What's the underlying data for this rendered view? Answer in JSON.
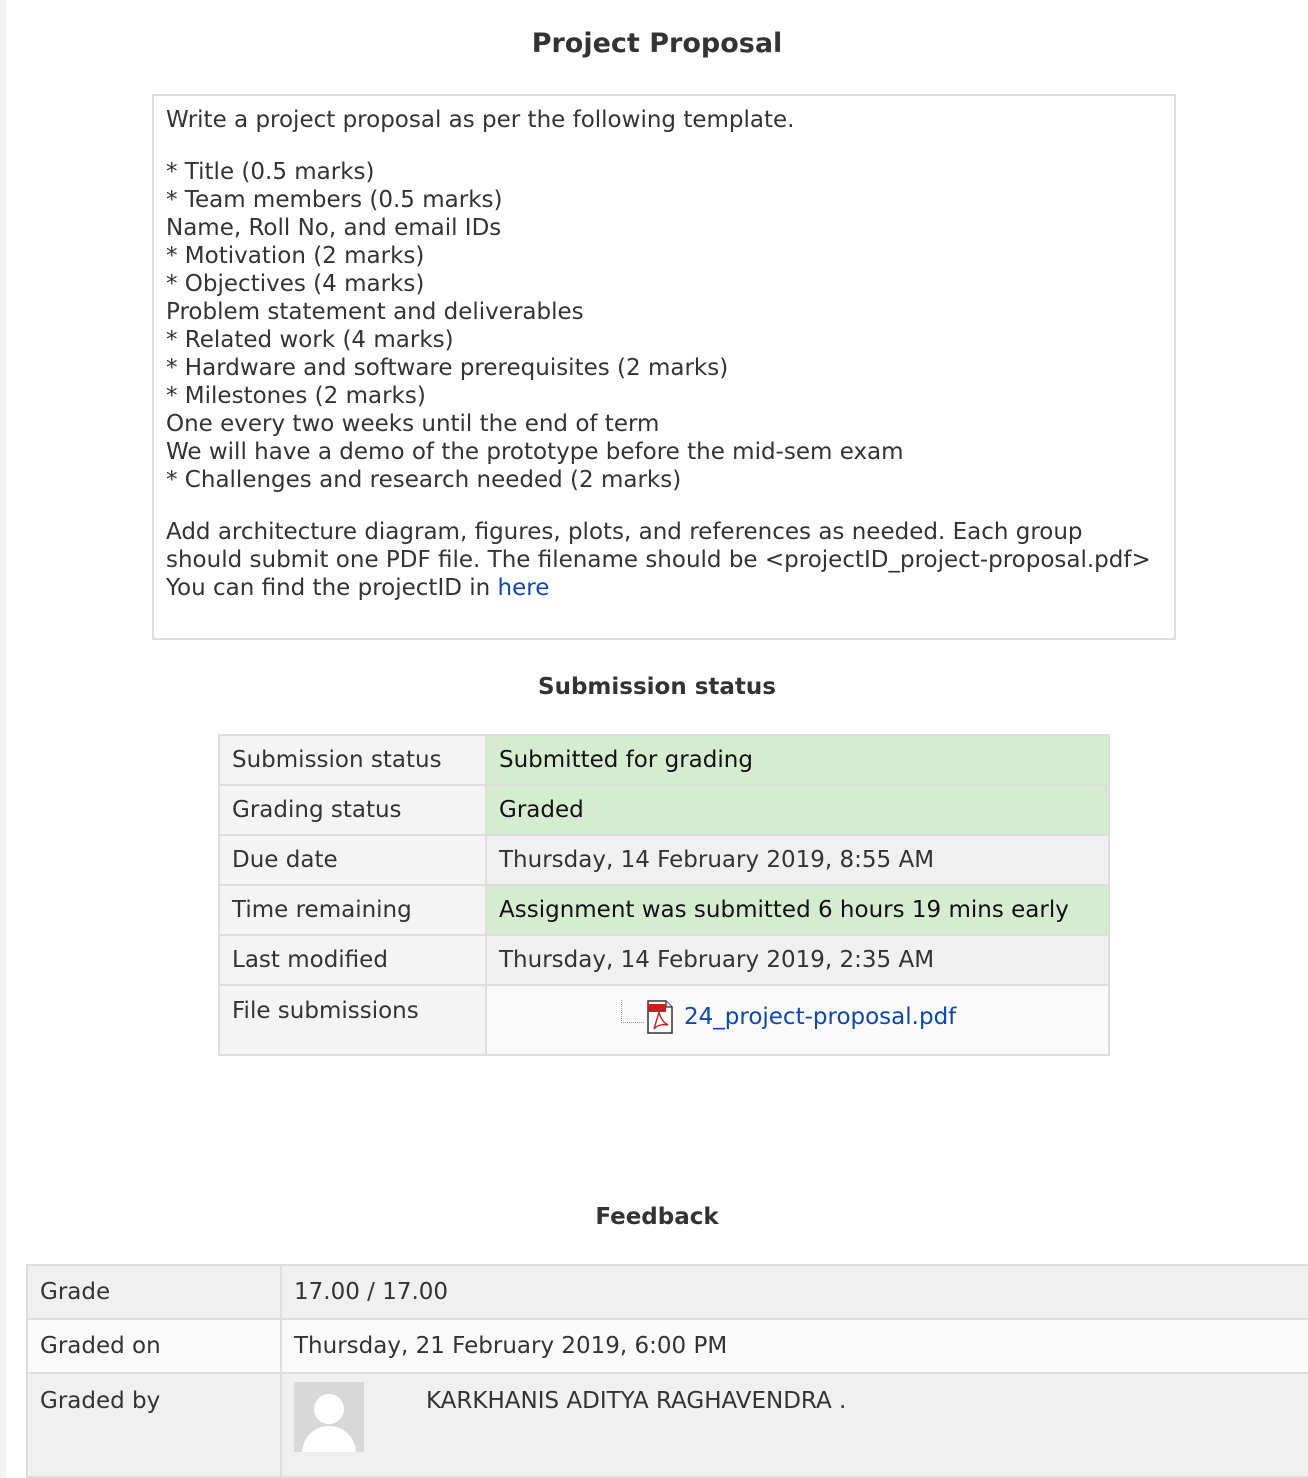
{
  "page": {
    "title": "Project Proposal"
  },
  "intro": {
    "lead": "Write a project proposal as per the following template.",
    "template_lines": [
      "* Title (0.5 marks)",
      "* Team members (0.5 marks)",
      "Name, Roll No, and email IDs",
      "* Motivation (2 marks)",
      "* Objectives (4 marks)",
      "Problem statement and deliverables",
      "* Related work (4 marks)",
      "* Hardware and software prerequisites (2 marks)",
      "* Milestones (2 marks)",
      "One every two weeks until the end of term",
      "We will have a demo of the prototype before the mid-sem exam",
      "* Challenges and research needed (2 marks)"
    ],
    "closing": "Add architecture diagram, figures, plots, and references as needed. Each group should submit one PDF file. The filename should be <projectID_project-proposal.pdf> You can find the projectID in ",
    "link_text": "here"
  },
  "submission": {
    "title": "Submission status",
    "rows": [
      {
        "label": "Submission status",
        "value": "Submitted for grading"
      },
      {
        "label": "Grading status",
        "value": "Graded"
      },
      {
        "label": "Due date",
        "value": "Thursday, 14 February 2019, 8:55 AM"
      },
      {
        "label": "Time remaining",
        "value": "Assignment was submitted 6 hours 19 mins early"
      },
      {
        "label": "Last modified",
        "value": "Thursday, 14 February 2019, 2:35 AM"
      },
      {
        "label": "File submissions",
        "file_name": "24_project-proposal.pdf"
      }
    ],
    "highlight_color": "#d5ecd1"
  },
  "feedback": {
    "title": "Feedback",
    "rows": [
      {
        "label": "Grade",
        "value": "17.00 / 17.00"
      },
      {
        "label": "Graded on",
        "value": "Thursday, 21 February 2019, 6:00 PM"
      },
      {
        "label": "Graded by",
        "grader_name": "KARKHANIS ADITYA RAGHAVENDRA ."
      }
    ]
  },
  "colors": {
    "link": "#0f47ad",
    "text": "#333333",
    "border": "#dedede"
  },
  "icons": {
    "file_icon": "pdf-file-icon",
    "avatar": "user-avatar-placeholder"
  }
}
